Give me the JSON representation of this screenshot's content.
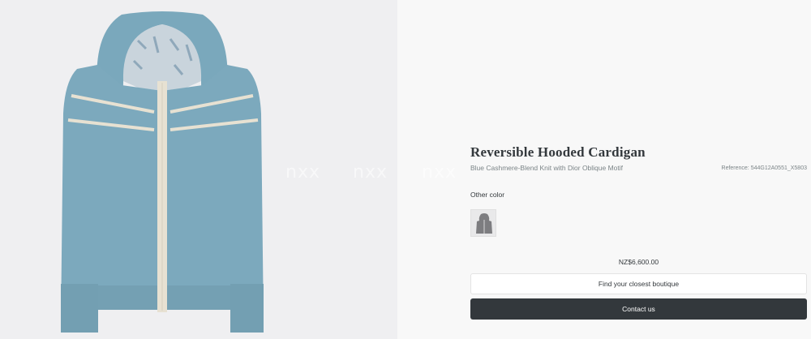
{
  "product": {
    "title": "Reversible Hooded Cardigan",
    "subtitle": "Blue Cashmere-Blend Knit with Dior Oblique Motif",
    "reference": "Reference: 544G12A0551_X5803",
    "other_color_label": "Other color",
    "price": "NZ$6,600.00"
  },
  "actions": {
    "boutique_label": "Find your closest boutique",
    "contact_label": "Contact us"
  },
  "watermark": {
    "marks": [
      "nxx",
      "nxx",
      "nxx"
    ]
  },
  "colors": {
    "knit_blue": "#79a7bb",
    "stripe_cream": "#e7e1d2",
    "button_dark": "#33383c",
    "swatch_grey": "#7d7d80"
  }
}
